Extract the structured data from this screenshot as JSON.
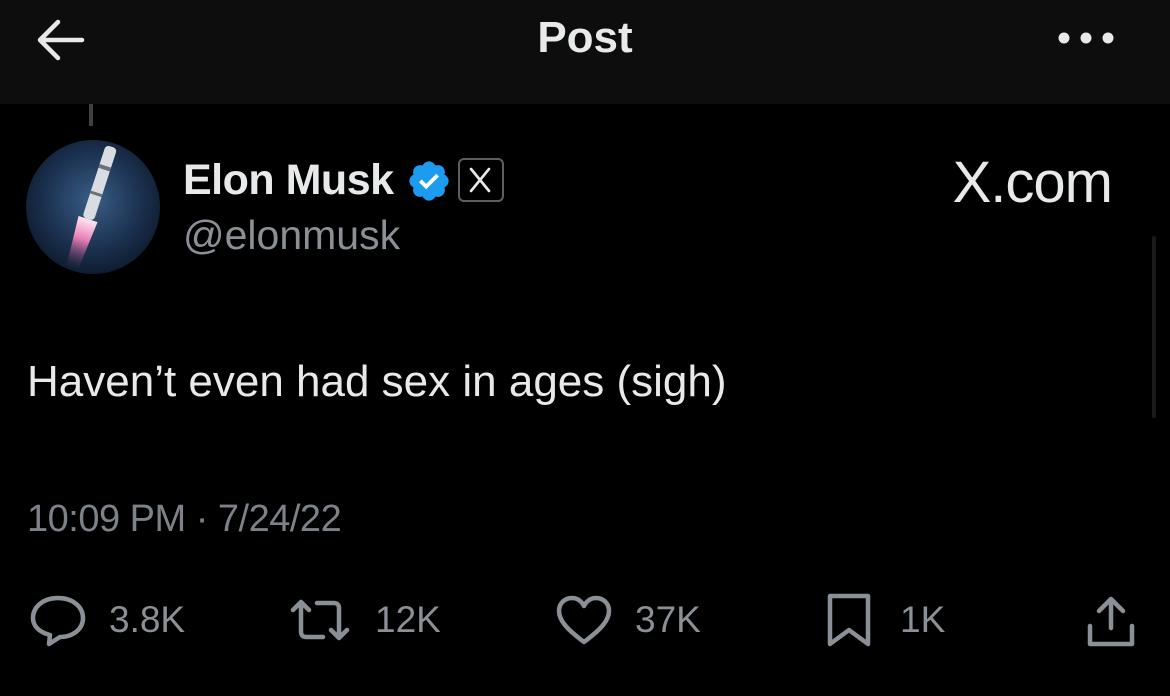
{
  "header": {
    "title": "Post"
  },
  "post": {
    "author": {
      "name": "Elon Musk",
      "handle": "@elonmusk",
      "verified": true,
      "affiliate_badge_text": "X"
    },
    "site_label": "X.com",
    "text": "Haven’t even had sex in ages (sigh)",
    "timestamp": "10:09 PM · 7/24/22"
  },
  "actions": {
    "replies": "3.8K",
    "reposts": "12K",
    "likes": "37K",
    "bookmarks": "1K"
  },
  "colors": {
    "background": "#000000",
    "header_background": "#0d0d0d",
    "primary_text": "#e7e9ea",
    "secondary_text": "#8b9096",
    "verified_blue": "#1d9bf0"
  },
  "icons": {
    "back": "arrow-left-icon",
    "more": "more-horizontal-icon",
    "verified": "verified-check-icon",
    "reply": "speech-bubble-icon",
    "repost": "repost-arrows-icon",
    "like": "heart-icon",
    "bookmark": "bookmark-icon",
    "share": "share-upload-icon"
  }
}
